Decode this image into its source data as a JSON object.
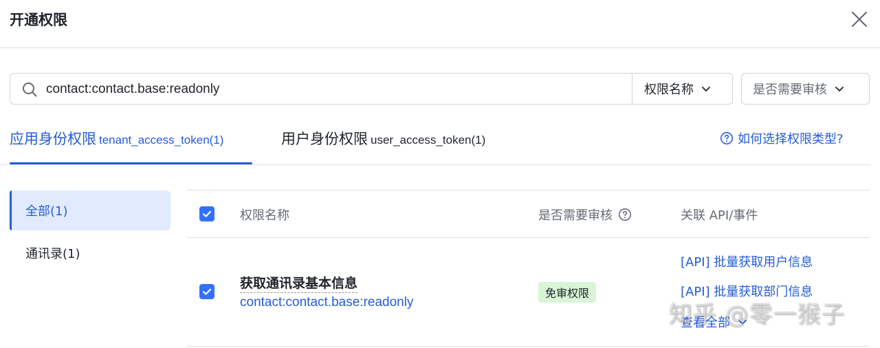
{
  "dialog": {
    "title": "开通权限",
    "close_icon": "close-icon"
  },
  "search": {
    "value": "contact:contact.base:readonly",
    "icon": "search-icon",
    "filter_label": "权限名称",
    "review_filter_label": "是否需要审核"
  },
  "tabs": {
    "app": {
      "label": "应用身份权限",
      "sub": "tenant_access_token(1)"
    },
    "user": {
      "label": "用户身份权限",
      "sub": "user_access_token(1)"
    },
    "help_link": "如何选择权限类型?"
  },
  "sidebar": {
    "items": [
      {
        "label": "全部(1)",
        "active": true
      },
      {
        "label": "通讯录(1)",
        "active": false
      }
    ]
  },
  "table": {
    "headers": {
      "name": "权限名称",
      "review": "是否需要审核",
      "related": "关联 API/事件"
    },
    "rows": [
      {
        "checked": true,
        "name": "获取通讯录基本信息",
        "code": "contact:contact.base:readonly",
        "badge": "免审权限",
        "apis": [
          "[API] 批量获取用户信息",
          "[API] 批量获取部门信息"
        ],
        "view_all": "查看全部"
      }
    ]
  },
  "watermark": "知乎 @零一猴子",
  "colors": {
    "accent": "#245bdb",
    "checkbox": "#3370ff",
    "badge_bg": "#d9f5d6",
    "active_bg": "#e1eaff"
  }
}
